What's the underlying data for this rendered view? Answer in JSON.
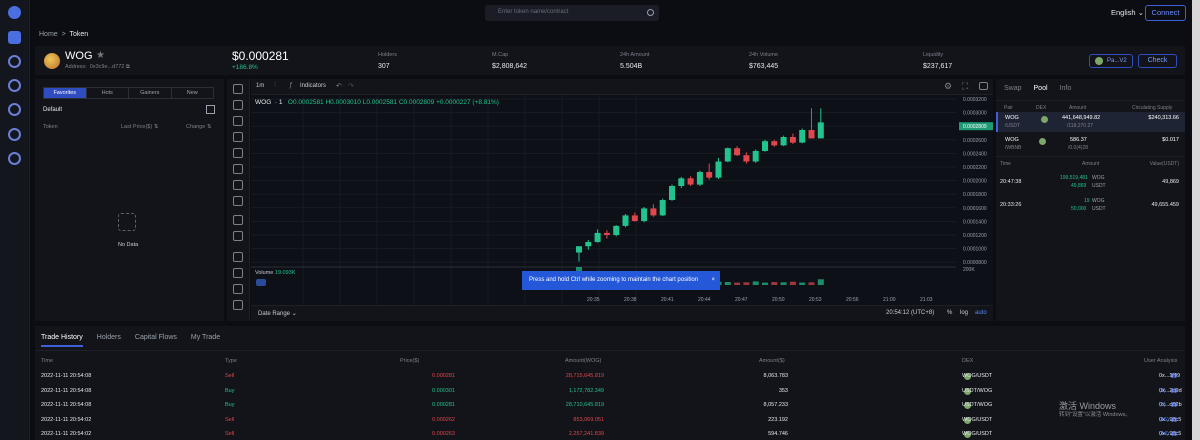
{
  "search": {
    "placeholder": "Enter token name/contract"
  },
  "header": {
    "language": "English",
    "connect_label": "Connect"
  },
  "breadcrumb": {
    "home": "Home",
    "sep": ">",
    "current": "Token"
  },
  "token": {
    "name": "WOG",
    "address_label": "Address:",
    "address": "0x3c9e...d772",
    "price": "$0.000281",
    "change": "+186.8%",
    "stats": [
      {
        "label": "Holders",
        "value": "307"
      },
      {
        "label": "M.Cap",
        "value": "$2,808,642"
      },
      {
        "label": "24h Amount",
        "value": "5.504B"
      },
      {
        "label": "24h Volume",
        "value": "$763,445"
      },
      {
        "label": "Liquidity",
        "value": "$237,617"
      }
    ],
    "pair_pill": "Pa...V2",
    "check_label": "Check"
  },
  "left_panel": {
    "tabs": [
      "Favorites",
      "Hots",
      "Gainers",
      "New"
    ],
    "group": "Default",
    "col_token": "Token",
    "col_price": "Last Price($)",
    "col_change": "Change",
    "empty": "No Data"
  },
  "chart": {
    "interval": "1m",
    "indicators_label": "Indicators",
    "symbol": "WOG",
    "symbol_num": "1",
    "ohlc": "O0.0002581 H0.0003010 L0.0002581 C0.0002809 +0.0000227 (+8.81%)",
    "volume_label": "Volume",
    "volume_value": "19.093K",
    "y_ticks": [
      "0.0003200",
      "0.0003000",
      "0.0002809",
      "0.0002600",
      "0.0002400",
      "0.0002200",
      "0.0002000",
      "0.0001800",
      "0.0001600",
      "0.0001400",
      "0.0001200",
      "0.0001000",
      "0.0000800"
    ],
    "vol_tick": "200K",
    "x_ticks": [
      "20:35",
      "20:38",
      "20:41",
      "20:44",
      "20:47",
      "20:50",
      "20:53",
      "20:56",
      "21:00",
      "21:03"
    ],
    "date_range": "Date Range",
    "clock": "20:54:12 (UTC+8)",
    "pct": "%",
    "log": "log",
    "auto": "auto",
    "toast": "Press and hold Ctrl while zooming to maintain the chart position",
    "colors": {
      "up": "#23c38e",
      "down": "#e0474c"
    }
  },
  "chart_data": {
    "type": "candlestick",
    "candles": [
      {
        "o": 9.5e-05,
        "h": 0.000103,
        "l": 8.2e-05,
        "c": 0.000104
      },
      {
        "o": 0.000104,
        "h": 0.000113,
        "l": 9.9e-05,
        "c": 0.00011
      },
      {
        "o": 0.00011,
        "h": 0.000128,
        "l": 0.000109,
        "c": 0.000123
      },
      {
        "o": 0.000123,
        "h": 0.000127,
        "l": 0.000115,
        "c": 0.00012
      },
      {
        "o": 0.00012,
        "h": 0.000134,
        "l": 0.000118,
        "c": 0.000133
      },
      {
        "o": 0.000133,
        "h": 0.00015,
        "l": 0.000131,
        "c": 0.000148
      },
      {
        "o": 0.000148,
        "h": 0.000152,
        "l": 0.000139,
        "c": 0.00014
      },
      {
        "o": 0.00014,
        "h": 0.00016,
        "l": 0.000138,
        "c": 0.000158
      },
      {
        "o": 0.000158,
        "h": 0.000164,
        "l": 0.000146,
        "c": 0.000148
      },
      {
        "o": 0.000148,
        "h": 0.000172,
        "l": 0.000147,
        "c": 0.00017
      },
      {
        "o": 0.00017,
        "h": 0.000192,
        "l": 0.000169,
        "c": 0.00019
      },
      {
        "o": 0.00019,
        "h": 0.000203,
        "l": 0.000187,
        "c": 0.000201
      },
      {
        "o": 0.000201,
        "h": 0.000204,
        "l": 0.00019,
        "c": 0.000192
      },
      {
        "o": 0.000192,
        "h": 0.000212,
        "l": 0.00019,
        "c": 0.00021
      },
      {
        "o": 0.00021,
        "h": 0.000222,
        "l": 0.000199,
        "c": 0.000202
      },
      {
        "o": 0.000202,
        "h": 0.00023,
        "l": 0.0002,
        "c": 0.000225
      },
      {
        "o": 0.000225,
        "h": 0.000245,
        "l": 0.000224,
        "c": 0.000244
      },
      {
        "o": 0.000244,
        "h": 0.000247,
        "l": 0.000233,
        "c": 0.000234
      },
      {
        "o": 0.000234,
        "h": 0.000238,
        "l": 0.000222,
        "c": 0.000225
      },
      {
        "o": 0.000225,
        "h": 0.000242,
        "l": 0.000223,
        "c": 0.00024
      },
      {
        "o": 0.00024,
        "h": 0.000256,
        "l": 0.000239,
        "c": 0.000254
      },
      {
        "o": 0.000254,
        "h": 0.000256,
        "l": 0.000246,
        "c": 0.000248
      },
      {
        "o": 0.000248,
        "h": 0.000262,
        "l": 0.000247,
        "c": 0.00026
      },
      {
        "o": 0.00026,
        "h": 0.000265,
        "l": 0.00025,
        "c": 0.000252
      },
      {
        "o": 0.000252,
        "h": 0.000272,
        "l": 0.000251,
        "c": 0.00027
      },
      {
        "o": 0.00027,
        "h": 0.000301,
        "l": 0.00026,
        "c": 0.000258
      },
      {
        "o": 0.0002581,
        "h": 0.000301,
        "l": 0.0002581,
        "c": 0.0002809
      }
    ],
    "volume": [
      60,
      14,
      10,
      12,
      9,
      11,
      14,
      9,
      12,
      8,
      10,
      13,
      10,
      7,
      9,
      11,
      10,
      8,
      9,
      12,
      8,
      10,
      9,
      11,
      8,
      9,
      19
    ],
    "ylim": [
      8e-05,
      0.00032
    ]
  },
  "pool": {
    "tabs": [
      "Swap",
      "Pool",
      "Info"
    ],
    "headers": [
      "Pair",
      "DEX",
      "Amount",
      "Circulating Supply"
    ],
    "pairs": [
      {
        "a": "WOG",
        "b": "/USDT",
        "amount1": "441,648,949.82",
        "amount2": "/118,270.27",
        "supply": "$240,313.66"
      },
      {
        "a": "WOG",
        "b": "/WBNB",
        "amount1": "586.37",
        "amount2": "/0.0(4)28",
        "supply": "$0.017"
      }
    ],
    "tx_headers": [
      "Time",
      "Amount",
      "Value(USDT)"
    ],
    "txs": [
      {
        "time": "20:47:38",
        "a1": "199,519,481",
        "u1": "WOG",
        "a2": "49,869",
        "u2": "USDT",
        "value": "49,869"
      },
      {
        "time": "20:33:26",
        "a1": "19",
        "u1": "WOG",
        "a2": "50,000",
        "u2": "USDT",
        "value": "49,655.459"
      }
    ]
  },
  "bottom": {
    "tabs": [
      "Trade History",
      "Holders",
      "Capital Flows",
      "My Trade"
    ],
    "headers": [
      "Time",
      "Type",
      "Price($)",
      "Amount(WOG)",
      "Amount($)",
      "DEX",
      "User Analysis"
    ],
    "rows": [
      {
        "time": "2022-11-11 20:54:08",
        "type": "Sell",
        "price": "0.000281",
        "amt": "28,715,645.819",
        "usd": "8,063.783",
        "dex": "WOG/USDT",
        "user": "0x...1f99",
        "cnt": ""
      },
      {
        "time": "2022-11-11 20:54:08",
        "type": "Buy",
        "price": "0.000301",
        "amt": "1,172,782.349",
        "usd": "353",
        "dex": "USDT/WOG",
        "user": "0x...2d9d",
        "cnt": "(2)"
      },
      {
        "time": "2022-11-11 20:54:08",
        "type": "Buy",
        "price": "0.000281",
        "amt": "28,710,645.819",
        "usd": "8,057.233",
        "dex": "USDT/WOG",
        "user": "0x...d82b",
        "cnt": "(6)"
      },
      {
        "time": "2022-11-11 20:54:02",
        "type": "Sell",
        "price": "0.000262",
        "amt": "853,069.051",
        "usd": "223.192",
        "dex": "WOG/USDT",
        "user": "0x...98c5",
        "cnt": "(16)"
      },
      {
        "time": "2022-11-11 20:54:02",
        "type": "Sell",
        "price": "0.000263",
        "amt": "2,257,241.839",
        "usd": "594.746",
        "dex": "WOG/USDT",
        "user": "0x...98c5",
        "cnt": "(14)"
      }
    ]
  },
  "watermark": {
    "line1": "激活 Windows",
    "line2": "转到\"设置\"以激活 Windows。"
  }
}
